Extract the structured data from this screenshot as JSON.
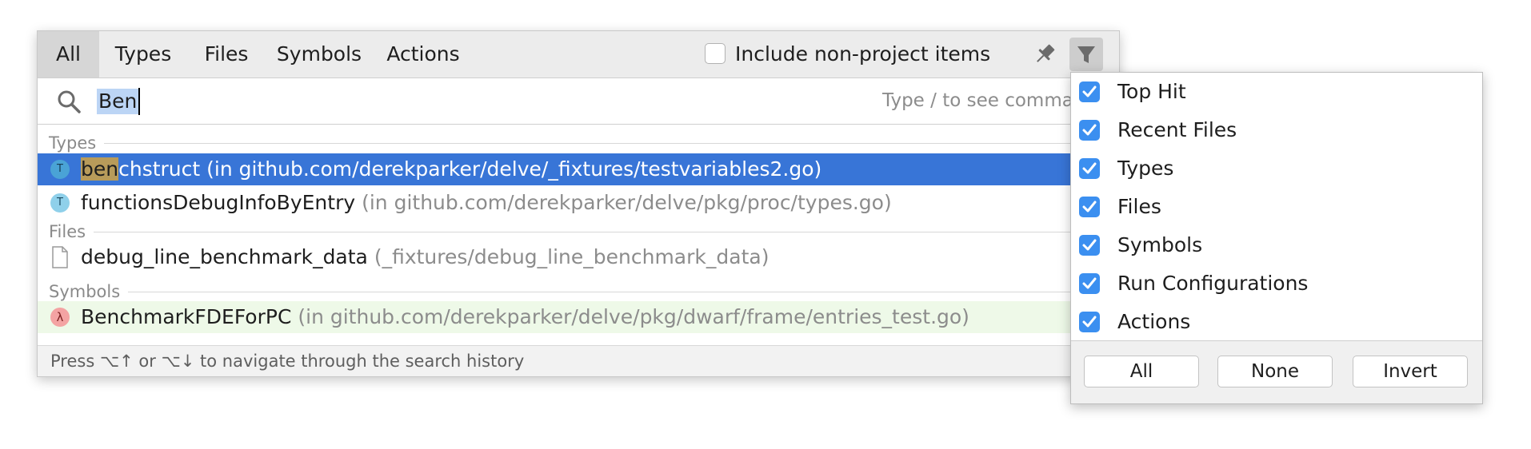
{
  "tabs": [
    "All",
    "Types",
    "Files",
    "Symbols",
    "Actions"
  ],
  "include_non_project_label": "Include non-project items",
  "search": {
    "query": "Ben",
    "hint": "Type / to see comma"
  },
  "groups": {
    "types": "Types",
    "files": "Files",
    "symbols": "Symbols"
  },
  "results": {
    "types": [
      {
        "icon": "T",
        "match": "ben",
        "rest": "chstruct",
        "location": " (in github.com/derekparker/delve/_fixtures/testvariables2.go)"
      },
      {
        "icon": "T",
        "name": "functionsDebugInfoByEntry",
        "location": " (in github.com/derekparker/delve/pkg/proc/types.go)"
      }
    ],
    "files": [
      {
        "name": "debug_line_benchmark_data",
        "location": " (_fixtures/debug_line_benchmark_data)"
      }
    ],
    "symbols": [
      {
        "icon": "λ",
        "name": "BenchmarkFDEForPC",
        "location": " (in github.com/derekparker/delve/pkg/dwarf/frame/entries_test.go)"
      }
    ]
  },
  "footer_hint": "Press ⌥↑ or ⌥↓ to navigate through the search history",
  "filter_menu": {
    "items": [
      "Top Hit",
      "Recent Files",
      "Types",
      "Files",
      "Symbols",
      "Run Configurations",
      "Actions"
    ],
    "buttons": {
      "all": "All",
      "none": "None",
      "invert": "Invert"
    }
  },
  "colors": {
    "selection": "#3875d7",
    "checkbox": "#3b8ff0",
    "symbol_row": "#eef9e8",
    "match_highlight": "#b89b5a"
  }
}
